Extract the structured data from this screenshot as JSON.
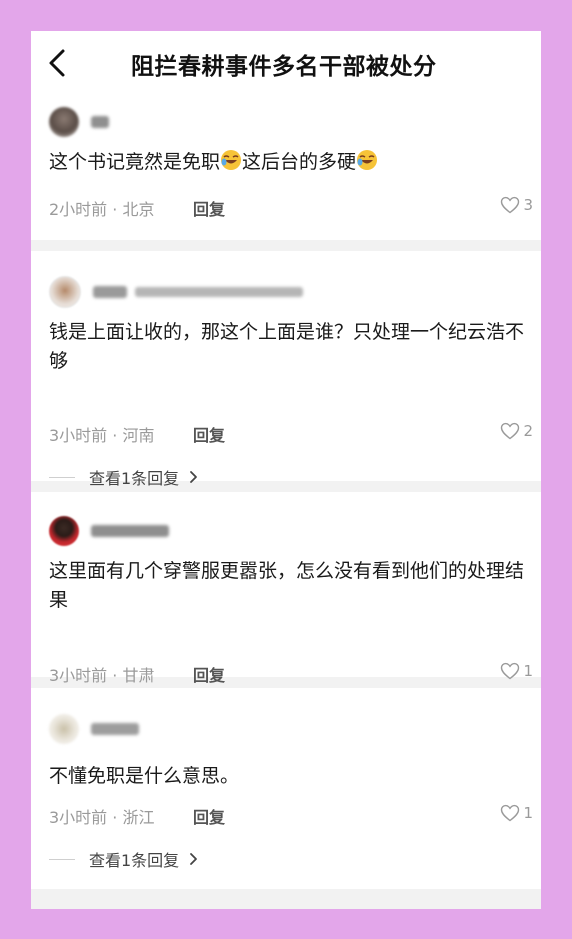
{
  "header": {
    "title": "阻拦春耕事件多名干部被处分"
  },
  "comments": [
    {
      "text_parts": [
        "这个书记竟然是免职",
        "这后台的多硬"
      ],
      "emoji": "rolling-on-floor-laughing",
      "time": "2小时前",
      "location": "北京",
      "reply_label": "回复",
      "likes": "3"
    },
    {
      "text": "钱是上面让收的，那这个上面是谁？只处理一个纪云浩不够",
      "time": "3小时前",
      "location": "河南",
      "reply_label": "回复",
      "likes": "2",
      "view_replies": "查看1条回复"
    },
    {
      "text": "这里面有几个穿警服更嚣张，怎么没有看到他们的处理结果",
      "time": "3小时前",
      "location": "甘肃",
      "reply_label": "回复",
      "likes": "1"
    },
    {
      "text": "不懂免职是什么意思。",
      "time": "3小时前",
      "location": "浙江",
      "reply_label": "回复",
      "likes": "1",
      "view_replies": "查看1条回复"
    }
  ],
  "colors": {
    "background": "#e3a6ea",
    "card": "#ffffff",
    "separator": "#f2f2f2",
    "meta_text": "#9a9a9a"
  },
  "icons": [
    "back-arrow-icon",
    "heart-outline-icon",
    "chevron-right-icon",
    "laughing-emoji-icon"
  ]
}
